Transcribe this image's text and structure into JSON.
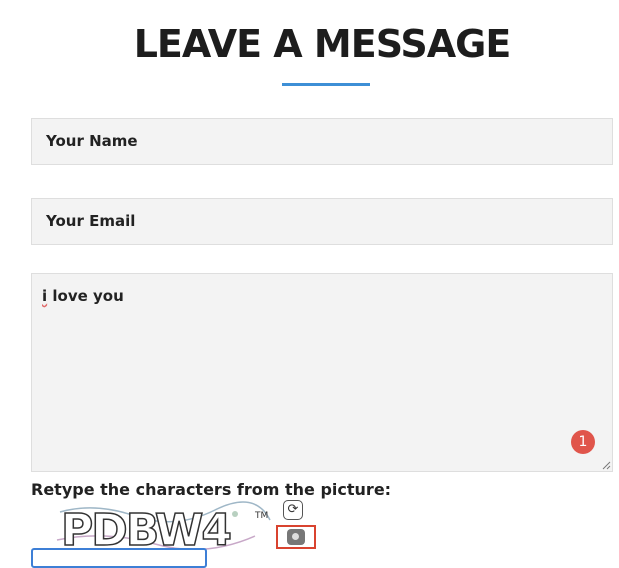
{
  "page": {
    "heading": "LEAVE A MESSAGE"
  },
  "form": {
    "name_placeholder": "Your Name",
    "email_placeholder": "Your Email",
    "message_value_first": "i",
    "message_value_rest": " love you",
    "notification_count": "1",
    "captcha_label": "Retype the characters from the picture:",
    "captcha_text": "PDBW4",
    "captcha_tm": "TM",
    "refresh_icon": "refresh-icon",
    "audio_icon": "audio-icon"
  },
  "colors": {
    "accent": "#3d8fd6",
    "badge": "#e0554b",
    "field_bg": "#f3f3f3"
  }
}
